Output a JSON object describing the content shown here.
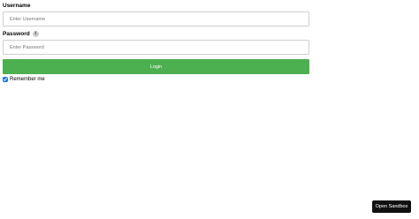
{
  "form": {
    "username": {
      "label": "Username",
      "placeholder": "Enter Username",
      "value": ""
    },
    "password": {
      "label": "Password",
      "info_icon": "i",
      "placeholder": "Enter Password",
      "value": ""
    },
    "login_label": "Login",
    "remember": {
      "label": "Remember me",
      "checked": true
    }
  },
  "sandbox_button_label": "Open Sandbox",
  "colors": {
    "login_button": "#4caf50",
    "sandbox_button": "#111111",
    "input_border": "#cfcfcf"
  },
  "icons": {
    "password_info": "info-icon"
  }
}
